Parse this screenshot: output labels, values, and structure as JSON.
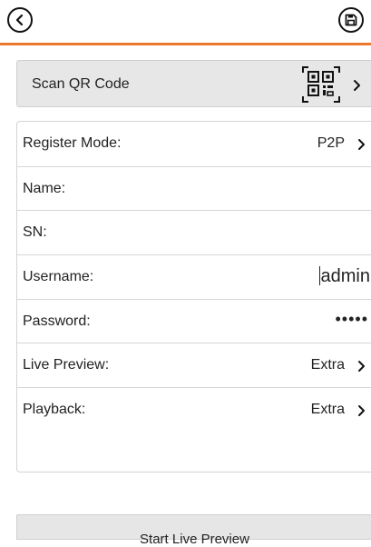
{
  "header": {
    "accent_color": "#e8792f",
    "back_icon": "back-chevron-icon",
    "save_icon": "save-disk-icon"
  },
  "scan": {
    "label": "Scan QR Code",
    "icon": "qr-code-icon"
  },
  "form": {
    "register_mode": {
      "label": "Register Mode:",
      "value": "P2P"
    },
    "name": {
      "label": "Name:",
      "value": ""
    },
    "sn": {
      "label": "SN:",
      "value": ""
    },
    "username": {
      "label": "Username:",
      "value": "admin"
    },
    "password": {
      "label": "Password:",
      "value": "•••••"
    },
    "live_preview": {
      "label": "Live Preview:",
      "value": "Extra"
    },
    "playback": {
      "label": "Playback:",
      "value": "Extra"
    }
  },
  "actions": {
    "start_live_preview": "Start Live Preview"
  }
}
